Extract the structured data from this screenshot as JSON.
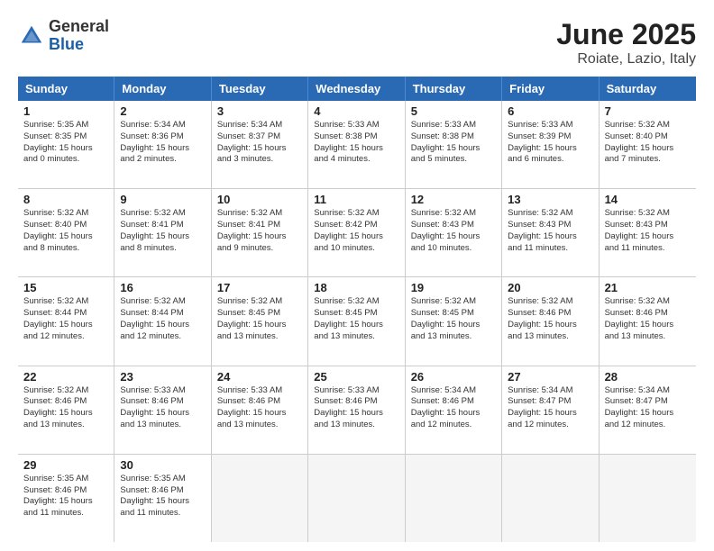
{
  "header": {
    "logo_general": "General",
    "logo_blue": "Blue",
    "title": "June 2025",
    "subtitle": "Roiate, Lazio, Italy"
  },
  "weekdays": [
    "Sunday",
    "Monday",
    "Tuesday",
    "Wednesday",
    "Thursday",
    "Friday",
    "Saturday"
  ],
  "rows": [
    [
      {
        "day": "1",
        "lines": [
          "Sunrise: 5:35 AM",
          "Sunset: 8:35 PM",
          "Daylight: 15 hours",
          "and 0 minutes."
        ]
      },
      {
        "day": "2",
        "lines": [
          "Sunrise: 5:34 AM",
          "Sunset: 8:36 PM",
          "Daylight: 15 hours",
          "and 2 minutes."
        ]
      },
      {
        "day": "3",
        "lines": [
          "Sunrise: 5:34 AM",
          "Sunset: 8:37 PM",
          "Daylight: 15 hours",
          "and 3 minutes."
        ]
      },
      {
        "day": "4",
        "lines": [
          "Sunrise: 5:33 AM",
          "Sunset: 8:38 PM",
          "Daylight: 15 hours",
          "and 4 minutes."
        ]
      },
      {
        "day": "5",
        "lines": [
          "Sunrise: 5:33 AM",
          "Sunset: 8:38 PM",
          "Daylight: 15 hours",
          "and 5 minutes."
        ]
      },
      {
        "day": "6",
        "lines": [
          "Sunrise: 5:33 AM",
          "Sunset: 8:39 PM",
          "Daylight: 15 hours",
          "and 6 minutes."
        ]
      },
      {
        "day": "7",
        "lines": [
          "Sunrise: 5:32 AM",
          "Sunset: 8:40 PM",
          "Daylight: 15 hours",
          "and 7 minutes."
        ]
      }
    ],
    [
      {
        "day": "8",
        "lines": [
          "Sunrise: 5:32 AM",
          "Sunset: 8:40 PM",
          "Daylight: 15 hours",
          "and 8 minutes."
        ]
      },
      {
        "day": "9",
        "lines": [
          "Sunrise: 5:32 AM",
          "Sunset: 8:41 PM",
          "Daylight: 15 hours",
          "and 8 minutes."
        ]
      },
      {
        "day": "10",
        "lines": [
          "Sunrise: 5:32 AM",
          "Sunset: 8:41 PM",
          "Daylight: 15 hours",
          "and 9 minutes."
        ]
      },
      {
        "day": "11",
        "lines": [
          "Sunrise: 5:32 AM",
          "Sunset: 8:42 PM",
          "Daylight: 15 hours",
          "and 10 minutes."
        ]
      },
      {
        "day": "12",
        "lines": [
          "Sunrise: 5:32 AM",
          "Sunset: 8:43 PM",
          "Daylight: 15 hours",
          "and 10 minutes."
        ]
      },
      {
        "day": "13",
        "lines": [
          "Sunrise: 5:32 AM",
          "Sunset: 8:43 PM",
          "Daylight: 15 hours",
          "and 11 minutes."
        ]
      },
      {
        "day": "14",
        "lines": [
          "Sunrise: 5:32 AM",
          "Sunset: 8:43 PM",
          "Daylight: 15 hours",
          "and 11 minutes."
        ]
      }
    ],
    [
      {
        "day": "15",
        "lines": [
          "Sunrise: 5:32 AM",
          "Sunset: 8:44 PM",
          "Daylight: 15 hours",
          "and 12 minutes."
        ]
      },
      {
        "day": "16",
        "lines": [
          "Sunrise: 5:32 AM",
          "Sunset: 8:44 PM",
          "Daylight: 15 hours",
          "and 12 minutes."
        ]
      },
      {
        "day": "17",
        "lines": [
          "Sunrise: 5:32 AM",
          "Sunset: 8:45 PM",
          "Daylight: 15 hours",
          "and 13 minutes."
        ]
      },
      {
        "day": "18",
        "lines": [
          "Sunrise: 5:32 AM",
          "Sunset: 8:45 PM",
          "Daylight: 15 hours",
          "and 13 minutes."
        ]
      },
      {
        "day": "19",
        "lines": [
          "Sunrise: 5:32 AM",
          "Sunset: 8:45 PM",
          "Daylight: 15 hours",
          "and 13 minutes."
        ]
      },
      {
        "day": "20",
        "lines": [
          "Sunrise: 5:32 AM",
          "Sunset: 8:46 PM",
          "Daylight: 15 hours",
          "and 13 minutes."
        ]
      },
      {
        "day": "21",
        "lines": [
          "Sunrise: 5:32 AM",
          "Sunset: 8:46 PM",
          "Daylight: 15 hours",
          "and 13 minutes."
        ]
      }
    ],
    [
      {
        "day": "22",
        "lines": [
          "Sunrise: 5:32 AM",
          "Sunset: 8:46 PM",
          "Daylight: 15 hours",
          "and 13 minutes."
        ]
      },
      {
        "day": "23",
        "lines": [
          "Sunrise: 5:33 AM",
          "Sunset: 8:46 PM",
          "Daylight: 15 hours",
          "and 13 minutes."
        ]
      },
      {
        "day": "24",
        "lines": [
          "Sunrise: 5:33 AM",
          "Sunset: 8:46 PM",
          "Daylight: 15 hours",
          "and 13 minutes."
        ]
      },
      {
        "day": "25",
        "lines": [
          "Sunrise: 5:33 AM",
          "Sunset: 8:46 PM",
          "Daylight: 15 hours",
          "and 13 minutes."
        ]
      },
      {
        "day": "26",
        "lines": [
          "Sunrise: 5:34 AM",
          "Sunset: 8:46 PM",
          "Daylight: 15 hours",
          "and 12 minutes."
        ]
      },
      {
        "day": "27",
        "lines": [
          "Sunrise: 5:34 AM",
          "Sunset: 8:47 PM",
          "Daylight: 15 hours",
          "and 12 minutes."
        ]
      },
      {
        "day": "28",
        "lines": [
          "Sunrise: 5:34 AM",
          "Sunset: 8:47 PM",
          "Daylight: 15 hours",
          "and 12 minutes."
        ]
      }
    ],
    [
      {
        "day": "29",
        "lines": [
          "Sunrise: 5:35 AM",
          "Sunset: 8:46 PM",
          "Daylight: 15 hours",
          "and 11 minutes."
        ]
      },
      {
        "day": "30",
        "lines": [
          "Sunrise: 5:35 AM",
          "Sunset: 8:46 PM",
          "Daylight: 15 hours",
          "and 11 minutes."
        ]
      },
      {
        "day": "",
        "lines": []
      },
      {
        "day": "",
        "lines": []
      },
      {
        "day": "",
        "lines": []
      },
      {
        "day": "",
        "lines": []
      },
      {
        "day": "",
        "lines": []
      }
    ]
  ]
}
